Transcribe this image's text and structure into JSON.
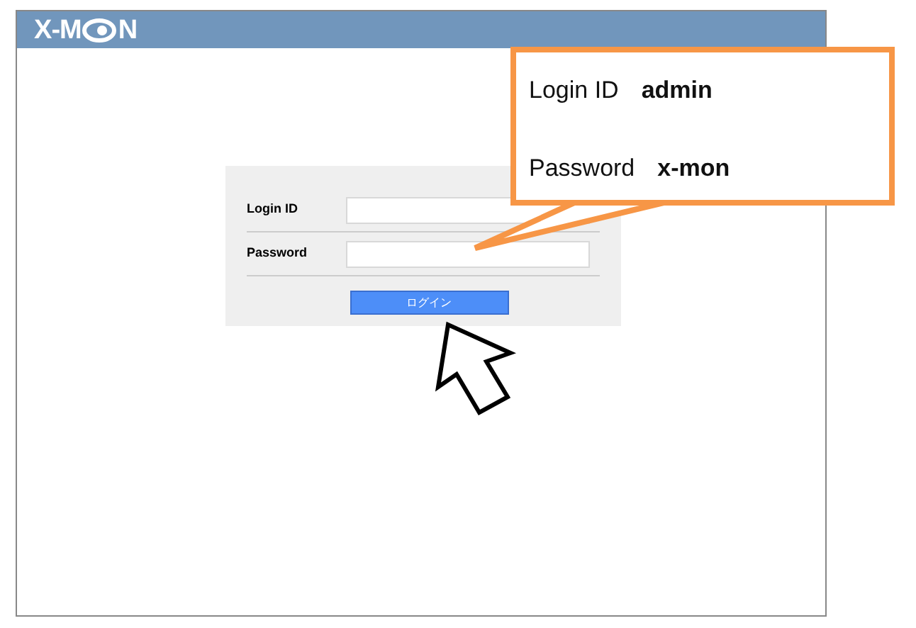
{
  "header": {
    "logo": [
      "X-M",
      "N"
    ]
  },
  "login_form": {
    "fields": [
      {
        "label": "Login ID"
      },
      {
        "label": "Password"
      }
    ],
    "button": "ログイン"
  },
  "callout": {
    "lines": [
      {
        "label": "Login ID",
        "value": "admin"
      },
      {
        "label": "Password",
        "value": "x-mon"
      }
    ]
  }
}
